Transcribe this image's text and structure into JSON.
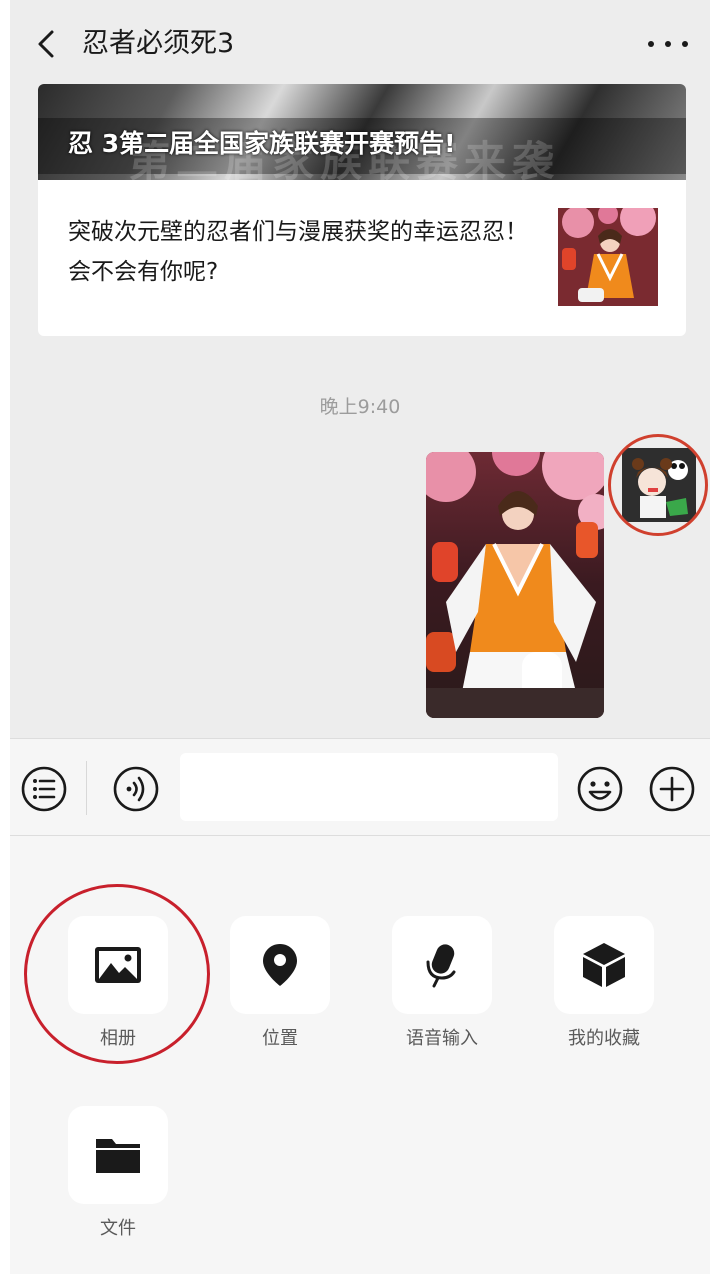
{
  "header": {
    "title": "忍者必须死3"
  },
  "article_card": {
    "banner_text": "忍 3第二届全国家族联赛开赛预告!",
    "banner_background_text": "第二届家族联赛来袭",
    "description": "突破次元壁的忍者们与漫展获奖的幸运忍忍！会不会有你呢?"
  },
  "chat": {
    "timestamp": "晚上9:40"
  },
  "input_bar": {
    "text_value": ""
  },
  "panel": {
    "tools": [
      {
        "label": "相册",
        "icon": "image-icon"
      },
      {
        "label": "位置",
        "icon": "location-icon"
      },
      {
        "label": "语音输入",
        "icon": "microphone-icon"
      },
      {
        "label": "我的收藏",
        "icon": "cube-icon"
      },
      {
        "label": "文件",
        "icon": "folder-icon"
      }
    ]
  },
  "colors": {
    "annotation_red": "#d0402e",
    "background": "#ededed",
    "panel": "#f6f6f6"
  }
}
